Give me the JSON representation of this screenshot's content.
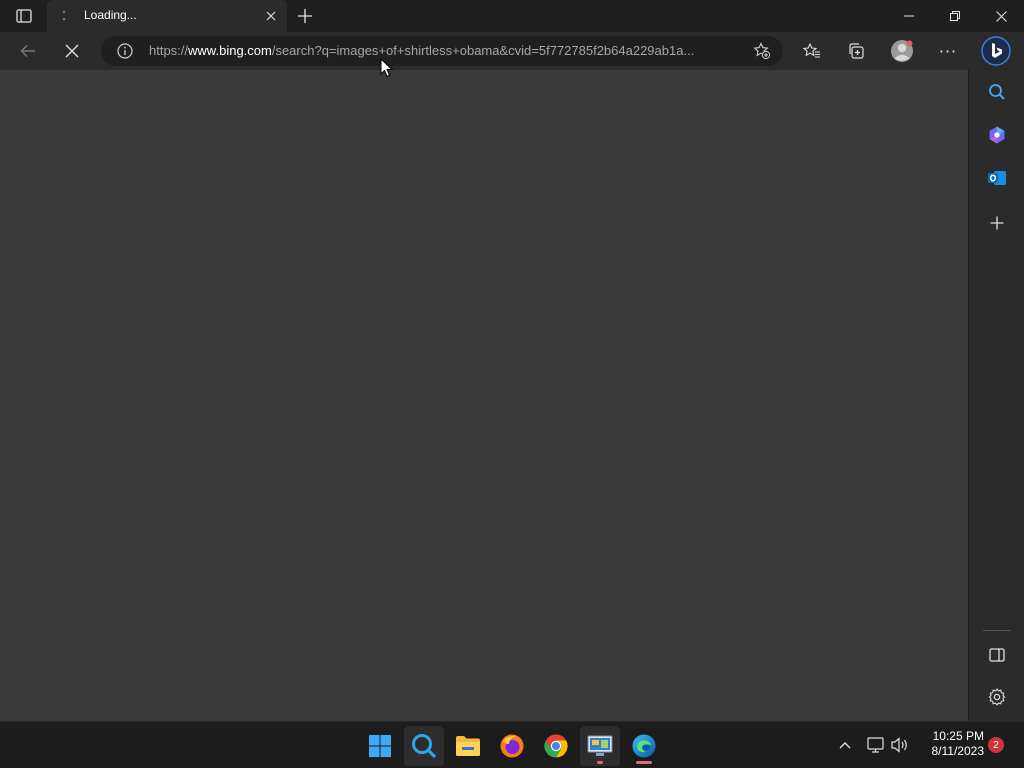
{
  "tab": {
    "title": "Loading...",
    "spinner_glyph": "⁚"
  },
  "address": {
    "scheme": "https://",
    "host": "www.bing.com",
    "path": "/search?q=images+of+shirtless+obama&cvid=5f772785f2b64a229ab1a..."
  },
  "window_controls": {
    "minimize": "—",
    "maximize": "❐",
    "close": "✕"
  },
  "toolbar": {
    "more_label": "···"
  },
  "sidebar": {
    "items": [
      "search-icon",
      "copilot-icon",
      "outlook-icon",
      "add-icon"
    ],
    "bottom_items": [
      "sidebar-toggle-icon",
      "settings-icon"
    ]
  },
  "taskbar": {
    "apps": [
      "start",
      "search",
      "file-explorer",
      "firefox",
      "chrome",
      "control-panel",
      "edge"
    ],
    "time": "10:25 PM",
    "date": "8/11/2023",
    "notifications": "2"
  },
  "colors": {
    "content_bg": "#3a3a3a",
    "chrome_bg": "#2b2b2b",
    "accent_blue": "#0078d4",
    "badge_red": "#d13438"
  }
}
